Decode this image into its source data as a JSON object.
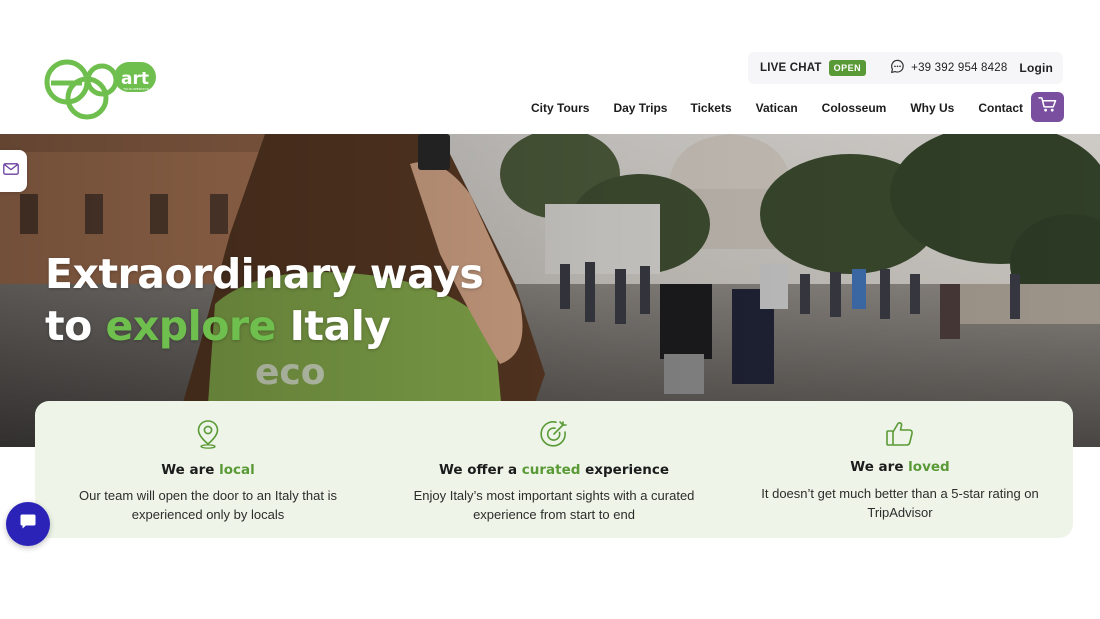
{
  "brand": {
    "logo_text": "ecoart",
    "logo_tagline": "TOUR OPERATOR",
    "logo_color": "#6fbf4e"
  },
  "topbar": {
    "live_chat_label": "LIVE CHAT",
    "live_chat_status": "OPEN",
    "phone": "+39 392 954 8428",
    "phone_icon": "chat-bubble-icon",
    "login_label": "Login"
  },
  "nav": {
    "items": [
      {
        "label": "City Tours"
      },
      {
        "label": "Day Trips"
      },
      {
        "label": "Tickets"
      },
      {
        "label": "Vatican"
      },
      {
        "label": "Colosseum"
      },
      {
        "label": "Why Us"
      },
      {
        "label": "Contact"
      }
    ],
    "cart_icon": "cart-icon",
    "cart_color": "#7a4fa0"
  },
  "hero": {
    "title_line1": "Extraordinary ways",
    "title_line2_pre": "to ",
    "title_line2_accent": "explore",
    "title_line2_post": " Italy",
    "accent_color": "#6fbf4e",
    "side_tab_icon": "mail-icon"
  },
  "features": [
    {
      "icon": "map-pin-icon",
      "title_pre": "We are ",
      "title_highlight": "local",
      "title_post": "",
      "text": "Our team will open the door to an Italy that is experienced only by locals"
    },
    {
      "icon": "target-icon",
      "title_pre": "We offer a ",
      "title_highlight": "curated",
      "title_post": " experience",
      "text": "Enjoy Italy’s most important sights with a curated experience from start to end"
    },
    {
      "icon": "thumbs-up-icon",
      "title_pre": "We are ",
      "title_highlight": "loved",
      "title_post": "",
      "text": "It doesn’t get much better than a 5-star rating on TripAdvisor"
    }
  ],
  "chat_widget": {
    "icon": "chat-icon",
    "color": "#2b22b8"
  }
}
